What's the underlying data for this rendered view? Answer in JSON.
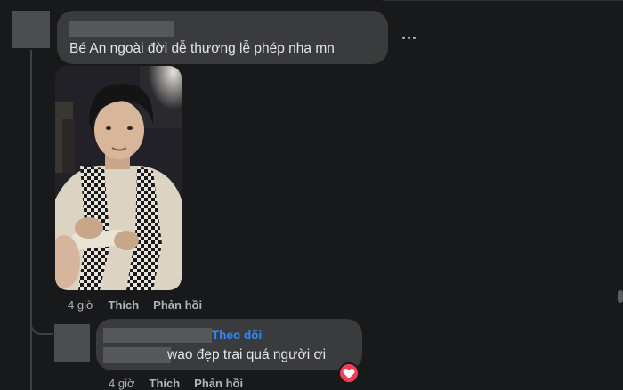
{
  "comments": [
    {
      "text": "Bé An ngoài đời dễ thương lễ phép nha mn",
      "time": "4 giờ",
      "like_label": "Thích",
      "reply_label": "Phản hồi",
      "more_icon": "more-horizontal-icon"
    },
    {
      "follow_label": "Theo dõi",
      "text": "wao đẹp trai quá người ơi",
      "time": "4 giờ",
      "like_label": "Thích",
      "reply_label": "Phản hồi",
      "reaction_icon": "heart-reaction-icon"
    }
  ],
  "colors": {
    "background": "#18191a",
    "bubble": "#3a3b3c",
    "text_primary": "#e4e6eb",
    "text_secondary": "#b0b3b8",
    "link": "#2d88ff",
    "heart": "#f33e58"
  }
}
